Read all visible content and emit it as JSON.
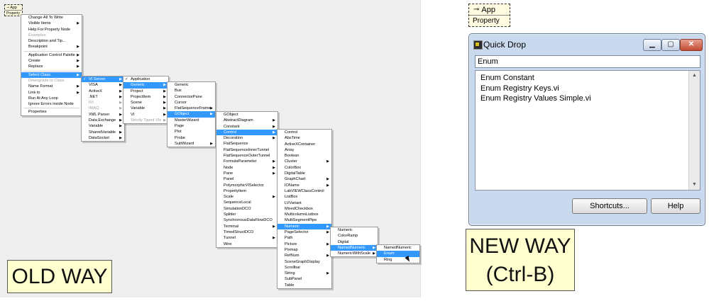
{
  "old_node": {
    "title": "App",
    "subtitle": "Property"
  },
  "new_node": {
    "title": "App",
    "subtitle": "Property"
  },
  "menus": {
    "main": [
      {
        "label": "Change All To Write"
      },
      {
        "label": "Visible Items",
        "arrow": true
      },
      {
        "label": "Help For Property Node"
      },
      {
        "label": "Examples",
        "disabled": true
      },
      {
        "label": "Description and Tip..."
      },
      {
        "label": "Breakpoint",
        "arrow": true
      },
      {
        "sep": true
      },
      {
        "label": "Application Control Palette",
        "arrow": true
      },
      {
        "label": "Create",
        "arrow": true
      },
      {
        "label": "Replace",
        "arrow": true
      },
      {
        "sep": true
      },
      {
        "label": "Select Class",
        "arrow": true,
        "hl": true
      },
      {
        "label": "Downgrade to Class",
        "disabled": true
      },
      {
        "label": "Name Format",
        "arrow": true
      },
      {
        "label": "Link to",
        "arrow": true
      },
      {
        "label": "Run At Any Loop"
      },
      {
        "label": "Ignore Errors inside Node"
      },
      {
        "sep": true
      },
      {
        "label": "Properties"
      }
    ],
    "class": [
      {
        "label": "VI Server",
        "arrow": true,
        "hl": true,
        "check": true
      },
      {
        "label": "VISA",
        "arrow": true
      },
      {
        "label": "ActiveX",
        "arrow": true
      },
      {
        "label": ".NET",
        "arrow": true
      },
      {
        "label": "IVI",
        "disabled": true,
        "arrow": true
      },
      {
        "label": "IMAQ",
        "disabled": true,
        "arrow": true
      },
      {
        "label": "XML Parser",
        "arrow": true
      },
      {
        "label": "Data Exchange",
        "arrow": true
      },
      {
        "label": "Variable",
        "arrow": true
      },
      {
        "label": "SharedVariable",
        "arrow": true
      },
      {
        "label": "DataSocket",
        "arrow": true
      }
    ],
    "vi_server": [
      {
        "label": "Application",
        "check": true
      },
      {
        "label": "Generic",
        "arrow": true,
        "hl": true
      },
      {
        "label": "Project",
        "arrow": true
      },
      {
        "label": "ProjectItem",
        "arrow": true
      },
      {
        "label": "Scene",
        "arrow": true
      },
      {
        "label": "Variable",
        "arrow": true
      },
      {
        "label": "VI",
        "arrow": true
      },
      {
        "label": "Strictly Typed VIs",
        "arrow": true,
        "disabled": true
      }
    ],
    "generic": [
      {
        "label": "Generic"
      },
      {
        "label": "Bus"
      },
      {
        "label": "ConnectorPane"
      },
      {
        "label": "Cursor"
      },
      {
        "label": "FlatSequenceFrame",
        "arrow": true
      },
      {
        "label": "GObject",
        "arrow": true,
        "hl": true
      },
      {
        "label": "MasterWizard"
      },
      {
        "label": "Page"
      },
      {
        "label": "Plot"
      },
      {
        "label": "Probe"
      },
      {
        "label": "SubWizard",
        "arrow": true
      }
    ],
    "gobject": [
      {
        "label": "GObject"
      },
      {
        "label": "AbstractDiagram",
        "arrow": true
      },
      {
        "label": "Constant",
        "arrow": true
      },
      {
        "label": "Control",
        "arrow": true,
        "hl": true
      },
      {
        "label": "Decoration",
        "arrow": true
      },
      {
        "label": "FlatSequence"
      },
      {
        "label": "FlatSequenceInnerTunnel"
      },
      {
        "label": "FlatSequenceOuterTunnel"
      },
      {
        "label": "FormulaParameter",
        "arrow": true
      },
      {
        "label": "Node",
        "arrow": true
      },
      {
        "label": "Pane",
        "arrow": true
      },
      {
        "label": "Panel"
      },
      {
        "label": "PolymorphicVISelector"
      },
      {
        "label": "PropertyItem"
      },
      {
        "label": "Scale",
        "arrow": true
      },
      {
        "label": "SequenceLocal"
      },
      {
        "label": "SimulationDCO"
      },
      {
        "label": "Splitter"
      },
      {
        "label": "SynchronousDataFlowDCO"
      },
      {
        "label": "Terminal",
        "arrow": true
      },
      {
        "label": "TimedStructDCO"
      },
      {
        "label": "Tunnel",
        "arrow": true
      },
      {
        "label": "Wire"
      }
    ],
    "control": [
      {
        "label": "Control"
      },
      {
        "label": "AbsTime"
      },
      {
        "label": "ActiveXContainer"
      },
      {
        "label": "Array"
      },
      {
        "label": "Boolean"
      },
      {
        "label": "Cluster",
        "arrow": true
      },
      {
        "label": "ColorBox"
      },
      {
        "label": "DigitalTable"
      },
      {
        "label": "GraphChart",
        "arrow": true
      },
      {
        "label": "IOName",
        "arrow": true
      },
      {
        "label": "LabVIEWClassControl"
      },
      {
        "label": "ListBox"
      },
      {
        "label": "LVVariant"
      },
      {
        "label": "MixedCheckbox"
      },
      {
        "label": "MulticolumnListbox"
      },
      {
        "label": "MultiSegmentPipe"
      },
      {
        "label": "Numeric",
        "arrow": true,
        "hl": true
      },
      {
        "label": "PageSelector",
        "arrow": true
      },
      {
        "label": "Path"
      },
      {
        "label": "Picture",
        "arrow": true
      },
      {
        "label": "Pixmap"
      },
      {
        "label": "RefNum",
        "arrow": true
      },
      {
        "label": "SceneGraphDisplay"
      },
      {
        "label": "Scrollbar"
      },
      {
        "label": "String",
        "arrow": true
      },
      {
        "label": "SubPanel"
      },
      {
        "label": "Table"
      }
    ],
    "numeric": [
      {
        "label": "Numeric"
      },
      {
        "label": "ColorRamp"
      },
      {
        "label": "Digital"
      },
      {
        "label": "NamedNumeric",
        "arrow": true,
        "hl": true
      },
      {
        "label": "NumericWithScale",
        "arrow": true
      }
    ],
    "named_numeric": [
      {
        "label": "NamedNumeric"
      },
      {
        "label": "Enum",
        "hl": true
      },
      {
        "label": "Ring"
      }
    ]
  },
  "old_label": "OLD WAY",
  "new_label_line1": "NEW WAY",
  "new_label_line2": "(Ctrl-B)",
  "quick_drop": {
    "title": "Quick Drop",
    "search_value": "Enum",
    "results": [
      "Enum Constant",
      "Enum Registry Keys.vi",
      "Enum Registry Values Simple.vi"
    ],
    "shortcuts_label": "Shortcuts...",
    "help_label": "Help"
  }
}
